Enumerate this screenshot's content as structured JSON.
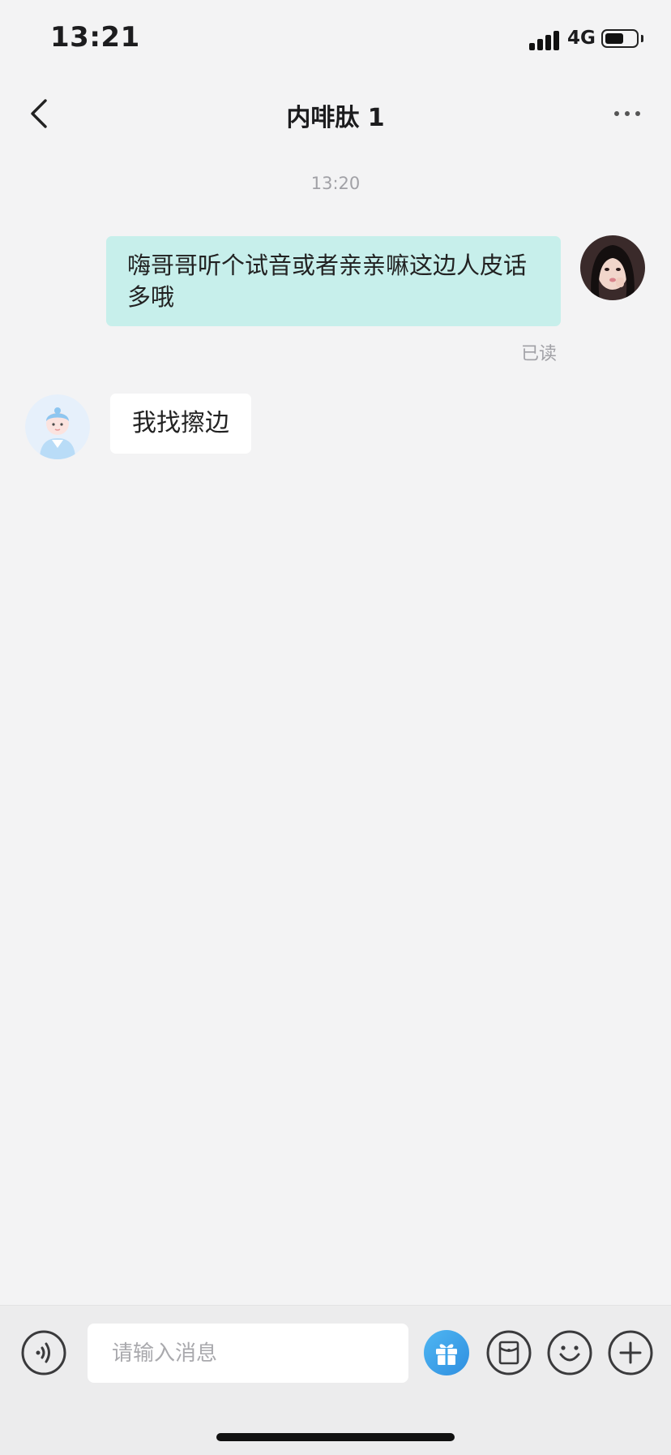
{
  "status_bar": {
    "time": "13:21",
    "network": "4G",
    "battery_percent": 50
  },
  "header": {
    "title": "内啡肽 1",
    "back_icon": "chevron-left-icon",
    "more_icon": "more-dots-icon"
  },
  "conversation": {
    "timestamp": "13:20",
    "messages": [
      {
        "from": "me",
        "text": "嗨哥哥听个试音或者亲亲嘛这边人皮话多哦",
        "status": "已读"
      },
      {
        "from": "other",
        "text": "我找擦边"
      }
    ]
  },
  "composer": {
    "voice_icon": "voice-icon",
    "placeholder": "请输入消息",
    "gift_icon": "gift-icon",
    "red_packet_icon": "red-packet-icon",
    "emoji_icon": "emoji-icon",
    "add_icon": "plus-icon"
  },
  "colors": {
    "background": "#f3f3f4",
    "outgoing_bubble": "#c7efeb",
    "incoming_bubble": "#ffffff",
    "gift_button": "#3aa3ea"
  }
}
